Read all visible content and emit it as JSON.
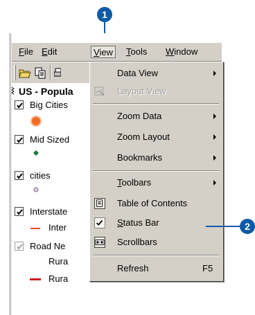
{
  "callouts": {
    "first": "1",
    "second": "2"
  },
  "menubar": {
    "items": [
      {
        "label_underlined": "F",
        "label_rest": "ile"
      },
      {
        "label_underlined": "E",
        "label_rest": "dit"
      },
      {
        "label_underlined": "V",
        "label_rest": "iew"
      },
      {
        "label_underlined": "T",
        "label_rest": "ools"
      },
      {
        "label_underlined": "W",
        "label_rest": "indow"
      }
    ]
  },
  "toc": {
    "title": "US - Popula",
    "layers": [
      {
        "label": "Big Cities",
        "checked": true
      },
      {
        "label": "Mid Sized",
        "checked": true
      },
      {
        "label": "cities",
        "checked": true
      },
      {
        "label": "Interstate",
        "checked": true
      },
      {
        "label": "Inter",
        "checked": null
      },
      {
        "label": "Road Ne",
        "checked": "gray"
      },
      {
        "label": "Rura",
        "checked": null
      },
      {
        "label": "Rura",
        "checked": null
      }
    ],
    "symbol_colors": {
      "big_cities": "#f26b22",
      "mid_sized": "#1a7a3a",
      "cities": "#e8c8e8",
      "interstate": "#e04a1a",
      "rural": "#d11c1c"
    }
  },
  "view_menu": {
    "items": [
      {
        "label": "Data View",
        "submenu": true
      },
      {
        "label": "Layout View",
        "disabled": true
      },
      {
        "label": "Zoom Data",
        "submenu": true
      },
      {
        "label": "Zoom Layout",
        "submenu": true
      },
      {
        "label": "Bookmarks",
        "submenu": true
      },
      {
        "label_underlined": "T",
        "label_rest": "oolbars",
        "submenu": true
      },
      {
        "label": "Table of Contents"
      },
      {
        "label_underlined": "S",
        "label_rest": "tatus Bar",
        "checked": true
      },
      {
        "label": "Scrollbars"
      },
      {
        "label": "Refresh",
        "shortcut": "F5"
      }
    ]
  },
  "colors": {
    "callout": "#0d5aa7",
    "menu_face": "#d4d0c8"
  }
}
